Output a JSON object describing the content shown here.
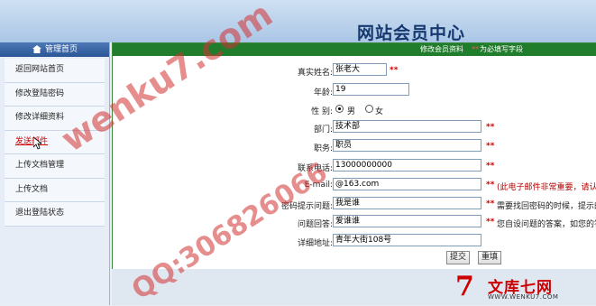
{
  "header": {
    "title": "网站会员中心"
  },
  "sidebar": {
    "title": "管理首页",
    "items": [
      {
        "label": "返回网站首页"
      },
      {
        "label": "修改登陆密码"
      },
      {
        "label": "修改详细资料"
      },
      {
        "label": "发送邮件"
      },
      {
        "label": "上传文档管理"
      },
      {
        "label": "上传文档"
      },
      {
        "label": "退出登陆状态"
      }
    ]
  },
  "form": {
    "banner": {
      "text": "修改会员资料",
      "star": "**",
      "hint": "为必填写字段"
    },
    "fields": {
      "realname": {
        "label": "真实姓名:",
        "value": "张老大",
        "req": "**"
      },
      "age": {
        "label": "年龄:",
        "value": "19"
      },
      "gender": {
        "label": "性  别:",
        "opt1": "男",
        "opt2": "女"
      },
      "dept": {
        "label": "部门:",
        "value": "技术部",
        "req": "**"
      },
      "position": {
        "label": "职务:",
        "value": "职员",
        "req": "**"
      },
      "phone": {
        "label": "联系电话:",
        "value": "13000000000",
        "req": "**"
      },
      "email": {
        "label": "E-mail:",
        "value": "@163.com",
        "req": "**",
        "note": "(此电子邮件非常重要，请认"
      },
      "question": {
        "label": "密码提示问题:",
        "value": "我是谁",
        "req": "**",
        "note": "需要找回密码的时候，提示的"
      },
      "answer": {
        "label": "问题回答:",
        "value": "爱谁谁",
        "req": "**",
        "note": "您自设问题的答案，如您的答"
      },
      "address": {
        "label": "详细地址:",
        "value": "青年大街108号"
      }
    },
    "submit_label": "提交",
    "reset_label": "重填"
  },
  "watermark": {
    "line1": "wenku7.com",
    "line2": "QQ:306826066",
    "logo_cn": "文库七网",
    "logo_url": "WWW.WENKU7.COM"
  }
}
